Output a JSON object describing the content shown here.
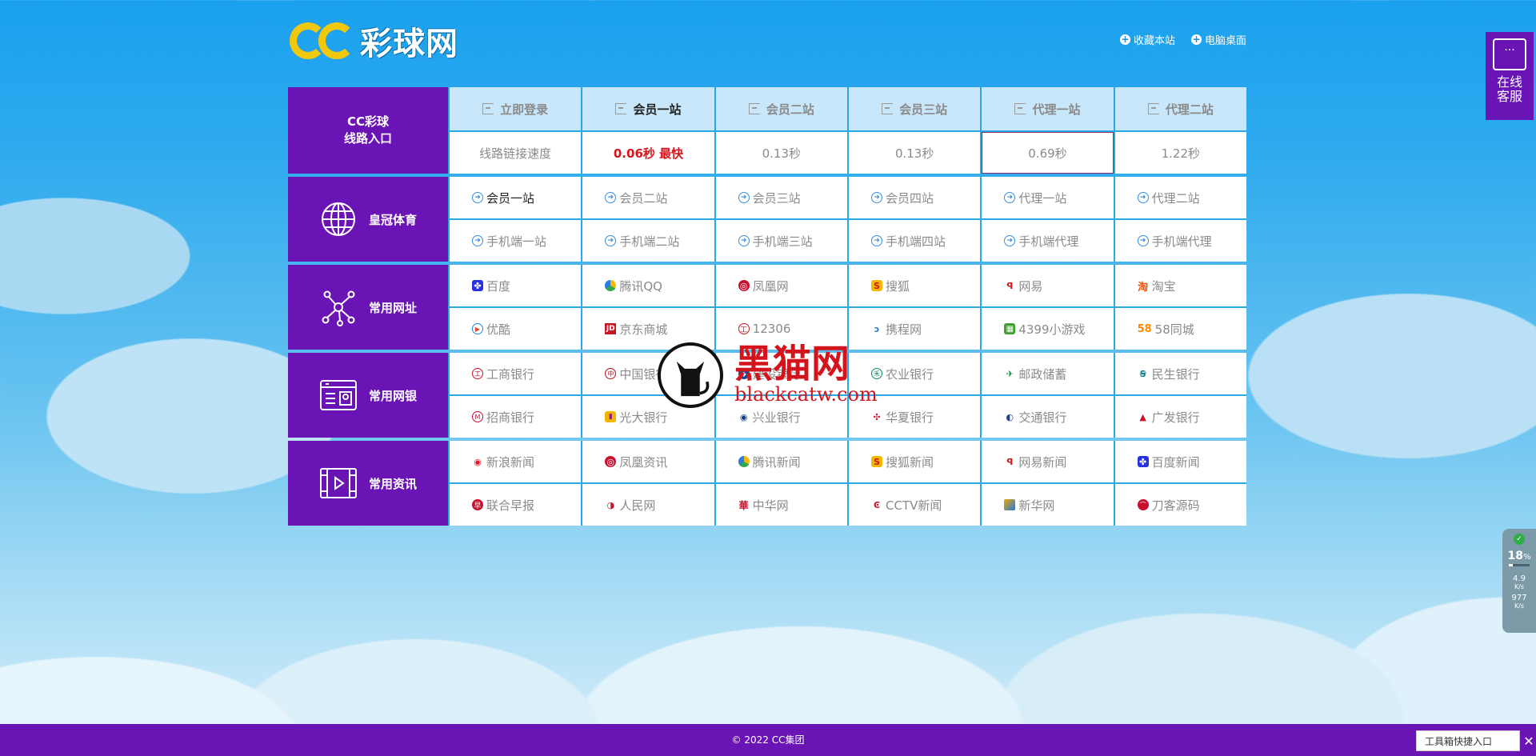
{
  "header": {
    "logo_text": "彩球网",
    "links": [
      "收藏本站",
      "电脑桌面"
    ]
  },
  "route": {
    "title_line1": "CC彩球",
    "title_line2": "线路入口",
    "top": [
      "立即登录",
      "会员一站",
      "会员二站",
      "会员三站",
      "代理一站",
      "代理二站"
    ],
    "bottom": [
      "线路链接速度",
      "0.06秒 最快",
      "0.13秒",
      "0.13秒",
      "0.69秒",
      "1.22秒"
    ]
  },
  "sports": {
    "title": "皇冠体育",
    "row1": [
      "会员一站",
      "会员二站",
      "会员三站",
      "会员四站",
      "代理一站",
      "代理二站"
    ],
    "row2": [
      "手机端一站",
      "手机端二站",
      "手机端三站",
      "手机端四站",
      "手机端代理",
      "手机端代理"
    ]
  },
  "sites": {
    "title": "常用网址",
    "row1": [
      "百度",
      "腾讯QQ",
      "凤凰网",
      "搜狐",
      "网易",
      "淘宝"
    ],
    "row2": [
      "优酷",
      "京东商城",
      "12306",
      "携程网",
      "4399小游戏",
      "58同城"
    ]
  },
  "banks": {
    "title": "常用网银",
    "row1": [
      "工商银行",
      "中国银行",
      "建设银行",
      "农业银行",
      "邮政储蓄",
      "民生银行"
    ],
    "row2": [
      "招商银行",
      "光大银行",
      "兴业银行",
      "华夏银行",
      "交通银行",
      "广发银行"
    ]
  },
  "news": {
    "title": "常用资讯",
    "row1": [
      "新浪新闻",
      "凤凰资讯",
      "腾讯新闻",
      "搜狐新闻",
      "网易新闻",
      "百度新闻"
    ],
    "row2": [
      "联合早报",
      "人民网",
      "中华网",
      "CCTV新闻",
      "新华网",
      "刀客源码"
    ]
  },
  "watermark": {
    "cn": "黑猫网",
    "en": "blackcatw.com"
  },
  "chat": {
    "line1": "在线",
    "line2": "客服"
  },
  "speed": {
    "percent": "18",
    "unit": "%",
    "up": "4.9",
    "down": "977",
    "rate_unit": "K/s"
  },
  "footer": {
    "text": "© 2022 CC集团"
  },
  "toolbox": {
    "label": "工具箱快捷入口"
  },
  "colors": {
    "purple": "#6b14b6",
    "blue_line": "#29a9e3",
    "fast_red": "#d8141c"
  }
}
